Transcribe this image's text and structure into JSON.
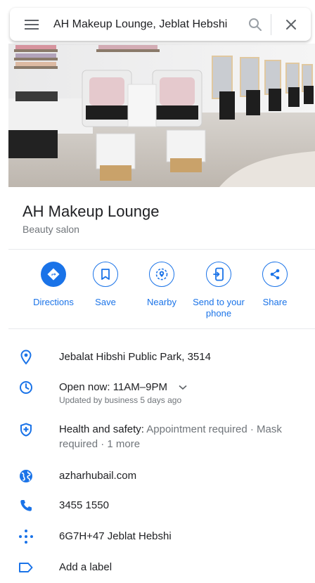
{
  "search": {
    "query": "AH Makeup Lounge, Jeblat Hebshi",
    "menu_icon": "hamburger-icon",
    "search_icon": "search-icon",
    "close_icon": "close-icon"
  },
  "place": {
    "name": "AH Makeup Lounge",
    "category": "Beauty salon"
  },
  "actions": [
    {
      "label": "Directions",
      "icon": "directions-icon"
    },
    {
      "label": "Save",
      "icon": "bookmark-icon"
    },
    {
      "label": "Nearby",
      "icon": "nearby-icon"
    },
    {
      "label": "Send to your phone",
      "line1": "Send to your",
      "line2": "phone",
      "icon": "send-to-phone-icon"
    },
    {
      "label": "Share",
      "icon": "share-icon"
    }
  ],
  "info": {
    "address": "Jebalat Hibshi Public Park, 3514",
    "hours": {
      "status": "Open now:",
      "range": "11AM–9PM",
      "updated": "Updated by business 5 days ago"
    },
    "health": {
      "title": "Health and safety:",
      "details_line1": "Appointment required · Mask",
      "details_line2": "required · 1 more"
    },
    "website": "azharhubail.com",
    "phone": "3455 1550",
    "plus_code": "6G7H+47 Jeblat Hebshi",
    "label": "Add a label"
  },
  "colors": {
    "accent": "#1a73e8",
    "text": "#202124",
    "secondary": "#70757a"
  }
}
